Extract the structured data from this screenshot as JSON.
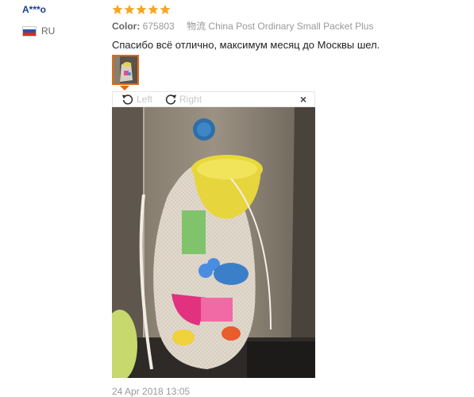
{
  "reviewer": {
    "name": "A***o",
    "country_code": "RU",
    "flag_colors": [
      "#ffffff",
      "#2c4fb0",
      "#d52b1e"
    ]
  },
  "review": {
    "rating": 5,
    "star_color": "#f5a623",
    "color_label": "Color:",
    "color_value": "675803",
    "shipping": "物流 China Post Ordinary Small Packet Plus",
    "text": "Спасибо всё отлично, максимум месяц до Москвы шел.",
    "date": "24 Apr 2018 13:05"
  },
  "viewer": {
    "rotate_left_label": "Left",
    "rotate_right_label": "Right",
    "close_label": "×",
    "accent_color": "#e06a12",
    "icons": [
      "rotate-left-icon",
      "rotate-right-icon",
      "close-icon"
    ]
  }
}
